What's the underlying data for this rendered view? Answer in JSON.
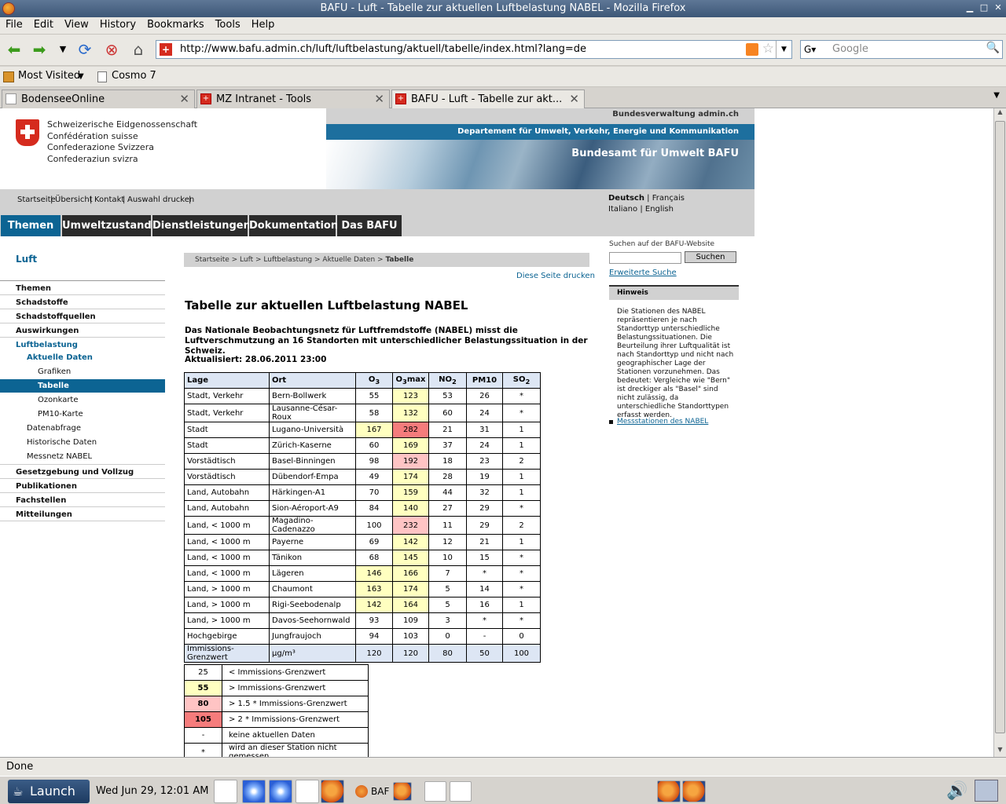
{
  "window": {
    "title": "BAFU - Luft - Tabelle zur aktuellen Luftbelastung NABEL - Mozilla Firefox"
  },
  "menu": [
    "File",
    "Edit",
    "View",
    "History",
    "Bookmarks",
    "Tools",
    "Help"
  ],
  "url": "http://www.bafu.admin.ch/luft/luftbelastung/aktuell/tabelle/index.html?lang=de",
  "search_placeholder": "Google",
  "bookmarks": {
    "most_visited": "Most Visited",
    "cosmo": "Cosmo 7"
  },
  "tabs": [
    {
      "label": "BodenseeOnline"
    },
    {
      "label": "MZ Intranet - Tools"
    },
    {
      "label": "BAFU - Luft - Tabelle zur akt..."
    }
  ],
  "status": "Done",
  "taskbar": {
    "launch": "Launch",
    "clock": "Wed Jun 29, 12:01 AM",
    "baf": "BAF"
  },
  "page": {
    "confederation": [
      "Schweizerische Eidgenossenschaft",
      "Confédération suisse",
      "Confederazione Svizzera",
      "Confederaziun svizra"
    ],
    "bundesverwaltung": "Bundesverwaltung admin.ch",
    "department": "Departement für Umwelt, Verkehr, Energie und Kommunikation",
    "office": "Bundesamt für Umwelt BAFU",
    "toplinks": [
      "Startseite",
      "Übersicht",
      "Kontakt",
      "Auswahl drucken"
    ],
    "lang": {
      "de": "Deutsch",
      "fr": "Français",
      "it": "Italiano",
      "en": "English"
    },
    "nav": [
      "Themen",
      "Umweltzustand",
      "Dienstleistungen",
      "Dokumentation",
      "Das BAFU"
    ],
    "left_title": "Luft",
    "left": {
      "themen": "Themen",
      "schadstoffe": "Schadstoffe",
      "quellen": "Schadstoffquellen",
      "auswirkungen": "Auswirkungen",
      "luftbelastung": "Luftbelastung",
      "aktuelle": "Aktuelle Daten",
      "grafiken": "Grafiken",
      "tabelle": "Tabelle",
      "ozonkarte": "Ozonkarte",
      "pm10": "PM10-Karte",
      "datenabfrage": "Datenabfrage",
      "historische": "Historische Daten",
      "messnetz": "Messnetz NABEL",
      "gesetz": "Gesetzgebung und Vollzug",
      "publikationen": "Publikationen",
      "fachstellen": "Fachstellen",
      "mitteilungen": "Mitteilungen"
    },
    "breadcrumb": [
      "Startseite",
      "Luft",
      "Luftbelastung",
      "Aktuelle Daten",
      "Tabelle"
    ],
    "print": "Diese Seite drucken",
    "heading": "Tabelle zur aktuellen Luftbelastung NABEL",
    "lead": "Das Nationale Beobachtungsnetz für Luftfremdstoffe (NABEL) misst die Luftverschmutzung an 16 Standorten mit unterschiedlicher Belastungssituation in der Schweiz.",
    "aktualisiert": "Aktualisiert: 28.06.2011 23:00",
    "table": {
      "headers": [
        "Lage",
        "Ort",
        "O3",
        "O3max",
        "NO2",
        "PM10",
        "SO2"
      ],
      "rows": [
        [
          "Stadt, Verkehr",
          "Bern-Bollwerk",
          "55",
          "123",
          "53",
          "26",
          "*"
        ],
        [
          "Stadt, Verkehr",
          "Lausanne-César-Roux",
          "58",
          "132",
          "60",
          "24",
          "*"
        ],
        [
          "Stadt",
          "Lugano-Università",
          "167",
          "282",
          "21",
          "31",
          "1"
        ],
        [
          "Stadt",
          "Zürich-Kaserne",
          "60",
          "169",
          "37",
          "24",
          "1"
        ],
        [
          "Vorstädtisch",
          "Basel-Binningen",
          "98",
          "192",
          "18",
          "23",
          "2"
        ],
        [
          "Vorstädtisch",
          "Dübendorf-Empa",
          "49",
          "174",
          "28",
          "19",
          "1"
        ],
        [
          "Land, Autobahn",
          "Härkingen-A1",
          "70",
          "159",
          "44",
          "32",
          "1"
        ],
        [
          "Land, Autobahn",
          "Sion-Aéroport-A9",
          "84",
          "140",
          "27",
          "29",
          "*"
        ],
        [
          "Land, < 1000 m",
          "Magadino-Cadenazzo",
          "100",
          "232",
          "11",
          "29",
          "2"
        ],
        [
          "Land, < 1000 m",
          "Payerne",
          "69",
          "142",
          "12",
          "21",
          "1"
        ],
        [
          "Land, < 1000 m",
          "Tänikon",
          "68",
          "145",
          "10",
          "15",
          "*"
        ],
        [
          "Land, < 1000 m",
          "Lägeren",
          "146",
          "166",
          "7",
          "*",
          "*"
        ],
        [
          "Land, > 1000 m",
          "Chaumont",
          "163",
          "174",
          "5",
          "14",
          "*"
        ],
        [
          "Land, > 1000 m",
          "Rigi-Seebodenalp",
          "142",
          "164",
          "5",
          "16",
          "1"
        ],
        [
          "Land, > 1000 m",
          "Davos-Seehornwald",
          "93",
          "109",
          "3",
          "*",
          "*"
        ],
        [
          "Hochgebirge",
          "Jungfraujoch",
          "94",
          "103",
          "0",
          "-",
          "0"
        ]
      ],
      "levels": [
        [
          "",
          "",
          "",
          "y",
          "",
          "",
          ""
        ],
        [
          "",
          "",
          "",
          "y",
          "",
          "",
          ""
        ],
        [
          "",
          "",
          "y",
          "r",
          "",
          "",
          ""
        ],
        [
          "",
          "",
          "",
          "y",
          "",
          "",
          ""
        ],
        [
          "",
          "",
          "",
          "p",
          "",
          "",
          ""
        ],
        [
          "",
          "",
          "",
          "y",
          "",
          "",
          ""
        ],
        [
          "",
          "",
          "",
          "y",
          "",
          "",
          ""
        ],
        [
          "",
          "",
          "",
          "y",
          "",
          "",
          ""
        ],
        [
          "",
          "",
          "",
          "p",
          "",
          "",
          ""
        ],
        [
          "",
          "",
          "",
          "y",
          "",
          "",
          ""
        ],
        [
          "",
          "",
          "",
          "y",
          "",
          "",
          ""
        ],
        [
          "",
          "",
          "y",
          "y",
          "",
          "",
          ""
        ],
        [
          "",
          "",
          "y",
          "y",
          "",
          "",
          ""
        ],
        [
          "",
          "",
          "y",
          "y",
          "",
          "",
          ""
        ],
        [
          "",
          "",
          "",
          "",
          "",
          "",
          ""
        ],
        [
          "",
          "",
          "",
          "",
          "",
          "",
          ""
        ]
      ],
      "footer": [
        "Immissions-Grenzwert",
        "µg/m³",
        "120",
        "120",
        "80",
        "50",
        "100"
      ]
    },
    "legend": [
      {
        "value": "25",
        "text": "< Immissions-Grenzwert",
        "level": ""
      },
      {
        "value": "55",
        "text": "> Immissions-Grenzwert",
        "level": "y"
      },
      {
        "value": "80",
        "text": "> 1.5 * Immissions-Grenzwert",
        "level": "p"
      },
      {
        "value": "105",
        "text": "> 2 * Immissions-Grenzwert",
        "level": "r"
      },
      {
        "value": "-",
        "text": "keine aktuellen Daten",
        "level": ""
      },
      {
        "value": "*",
        "text": "wird an dieser Station nicht gemessen",
        "level": ""
      }
    ],
    "search_label": "Suchen auf der BAFU-Website",
    "search_button": "Suchen",
    "erweiterte": "Erweiterte Suche",
    "hinweis_title": "Hinweis",
    "hinweis_text": "Die Stationen des NABEL repräsentieren je nach Standorttyp unterschiedliche Belastungssituationen. Die Beurteilung ihrer Luftqualität ist nach Standorttyp und nicht nach geographischer Lage der Stationen vorzunehmen. Das bedeutet: Vergleiche wie \"Bern\" ist dreckiger als \"Basel\" sind nicht zulässig, da unterschiedliche Standorttypen erfasst werden.",
    "messstationen": "Messstationen des NABEL"
  }
}
